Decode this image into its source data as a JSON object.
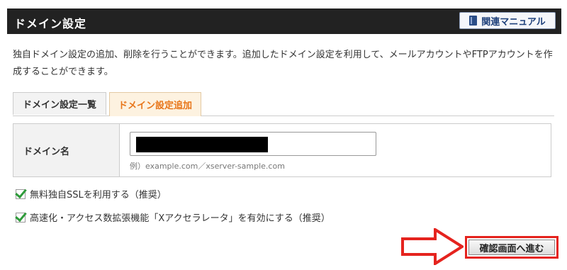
{
  "header": {
    "title": "ドメイン設定",
    "manual_button": "関連マニュアル"
  },
  "description": "独自ドメイン設定の追加、削除を行うことができます。追加したドメイン設定を利用して、メールアカウントやFTPアカウントを作成することができます。",
  "tabs": [
    {
      "label": "ドメイン設定一覧",
      "active": false
    },
    {
      "label": "ドメイン設定追加",
      "active": true
    }
  ],
  "form": {
    "domain_label": "ドメイン名",
    "domain_value": "",
    "domain_hint": "例）example.com／xserver-sample.com"
  },
  "options": [
    {
      "label": "無料独自SSLを利用する（推奨）",
      "checked": true
    },
    {
      "label": "高速化・アクセス数拡張機能「Xアクセラレータ」を有効にする（推奨）",
      "checked": true
    }
  ],
  "confirm_button": "確認画面へ進む",
  "colors": {
    "header_bg": "#222222",
    "active_tab_text": "#e8761a",
    "highlight_red": "#e5231e",
    "check_green": "#2e9b3a"
  }
}
